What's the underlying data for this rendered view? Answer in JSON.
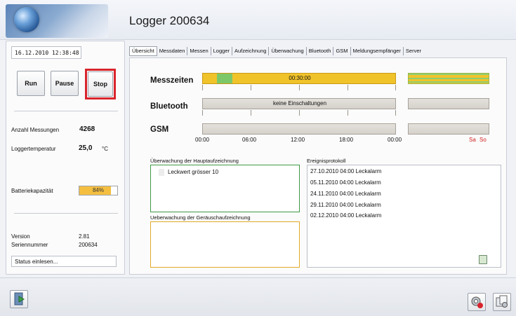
{
  "app": {
    "title": "Logger 200634"
  },
  "left": {
    "datetime": "16.12.2010 12:38:48",
    "buttons": {
      "run": "Run",
      "pause": "Pause",
      "stop": "Stop"
    },
    "measurements_label": "Anzahl Messungen",
    "measurements_value": "4268",
    "temp_label": "Loggertemperatur",
    "temp_value": "25,0",
    "temp_unit": "°C",
    "battery_label": "Batteriekapazität",
    "battery_percent": 84,
    "battery_text": "84%",
    "version_label": "Version",
    "version_value": "2.81",
    "serial_label": "Seriennummer",
    "serial_value": "200634",
    "status": "Status einlesen..."
  },
  "tabs": [
    "Übersicht",
    "Messdaten",
    "Messen",
    "Logger",
    "Aufzeichnung",
    "Überwachung",
    "Bluetooth",
    "GSM",
    "Meldungsempfänger",
    "Server"
  ],
  "overview": {
    "messzeiten_label": "Messzeiten",
    "messzeiten_text": "00:30:00",
    "bluetooth_label": "Bluetooth",
    "bluetooth_text": "keine Einschaltungen",
    "gsm_label": "GSM",
    "axis": [
      "00:00",
      "06:00",
      "12:00",
      "18:00",
      "00:00"
    ],
    "weekend": [
      "Sa",
      "So"
    ],
    "haupt_title": "Überwachung der Hauptaufzeichnung",
    "haupt_item": "Leckwert grösser 10",
    "geraeusch_title": "Ueberwachung der Geräuschaufzeichnung",
    "protokoll_title": "Ereignisprotokoll",
    "events": [
      "27.10.2010 04:00 Leckalarm",
      "05.11.2010 04:00 Leckalarm",
      "24.11.2010 04:00 Leckalarm",
      "29.11.2010 04:00 Leckalarm",
      "02.12.2010 04:00 Leckalarm"
    ]
  },
  "colors": {
    "stop_highlight": "#d9242c",
    "schedule": "#f1c32b",
    "battery": "#f4bf40",
    "weekend": "#d21d1d"
  }
}
